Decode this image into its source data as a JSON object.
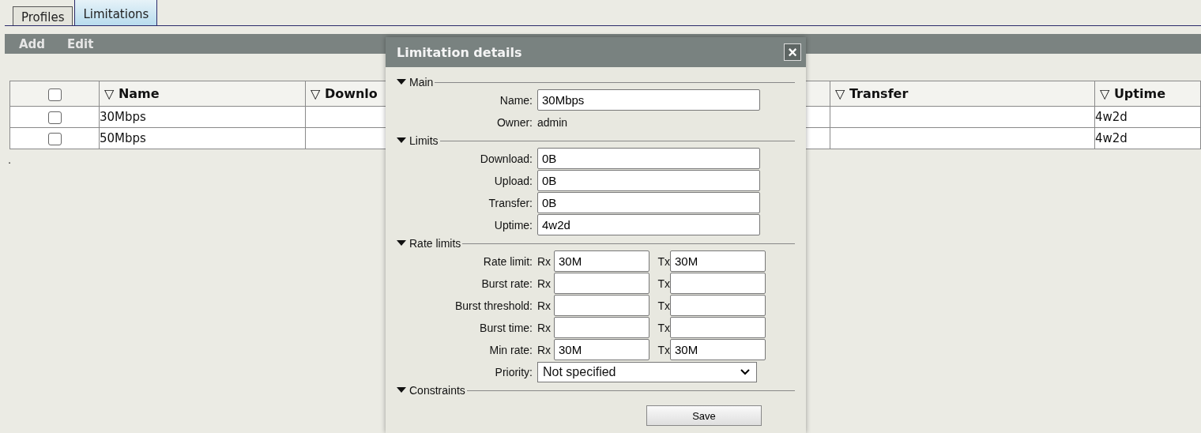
{
  "tabs": [
    {
      "label": "Profiles",
      "selected": false
    },
    {
      "label": "Limitations",
      "selected": true
    }
  ],
  "toolbar": [
    "Add",
    "Edit"
  ],
  "table": {
    "header_checked": false,
    "columns": [
      {
        "kind": "checkbox"
      },
      {
        "kind": "text",
        "label": "▽ Name"
      },
      {
        "kind": "text",
        "label": "▽ Downlo"
      },
      {
        "kind": "text",
        "label": "▽ Transfer"
      },
      {
        "kind": "text",
        "label": "▽ Uptime"
      }
    ],
    "rows": [
      {
        "checked": false,
        "cells": [
          "30Mbps",
          "",
          "",
          "4w2d"
        ]
      },
      {
        "checked": false,
        "cells": [
          "50Mbps",
          "",
          "",
          "4w2d"
        ]
      }
    ]
  },
  "note": ".",
  "dialog": {
    "title": "Limitation details",
    "close": "×",
    "sections": [
      {
        "title": "Main",
        "expanded": true,
        "fields": [
          {
            "kind": "text",
            "label": "Name:",
            "value": "30Mbps"
          },
          {
            "kind": "static",
            "label": "Owner:",
            "value": "admin"
          }
        ]
      },
      {
        "title": "Limits",
        "expanded": true,
        "fields": [
          {
            "kind": "text",
            "label": "Download:",
            "value": "0B"
          },
          {
            "kind": "text",
            "label": "Upload:",
            "value": "0B"
          },
          {
            "kind": "text",
            "label": "Transfer:",
            "value": "0B"
          },
          {
            "kind": "text",
            "label": "Uptime:",
            "value": "4w2d"
          }
        ]
      },
      {
        "title": "Rate limits",
        "expanded": true,
        "fields": [
          {
            "kind": "pair",
            "label": "Rate limit:",
            "rx_label": "Rx",
            "rx_value": "30M",
            "tx_label": "Tx",
            "tx_value": "30M"
          },
          {
            "kind": "pair",
            "label": "Burst rate:",
            "rx_label": "Rx",
            "tx_label": "Tx"
          },
          {
            "kind": "pair",
            "label": "Burst threshold:",
            "rx_label": "Rx",
            "tx_label": "Tx"
          },
          {
            "kind": "pair",
            "label": "Burst time:",
            "rx_label": "Rx",
            "tx_label": "Tx"
          },
          {
            "kind": "pair",
            "label": "Min rate:",
            "rx_label": "Rx",
            "rx_value": "30M",
            "tx_label": "Tx",
            "tx_value": "30M"
          },
          {
            "kind": "select",
            "label": "Priority:",
            "value": "Not specified"
          }
        ]
      },
      {
        "title": "Constraints",
        "expanded": true
      }
    ],
    "save": "Save"
  }
}
